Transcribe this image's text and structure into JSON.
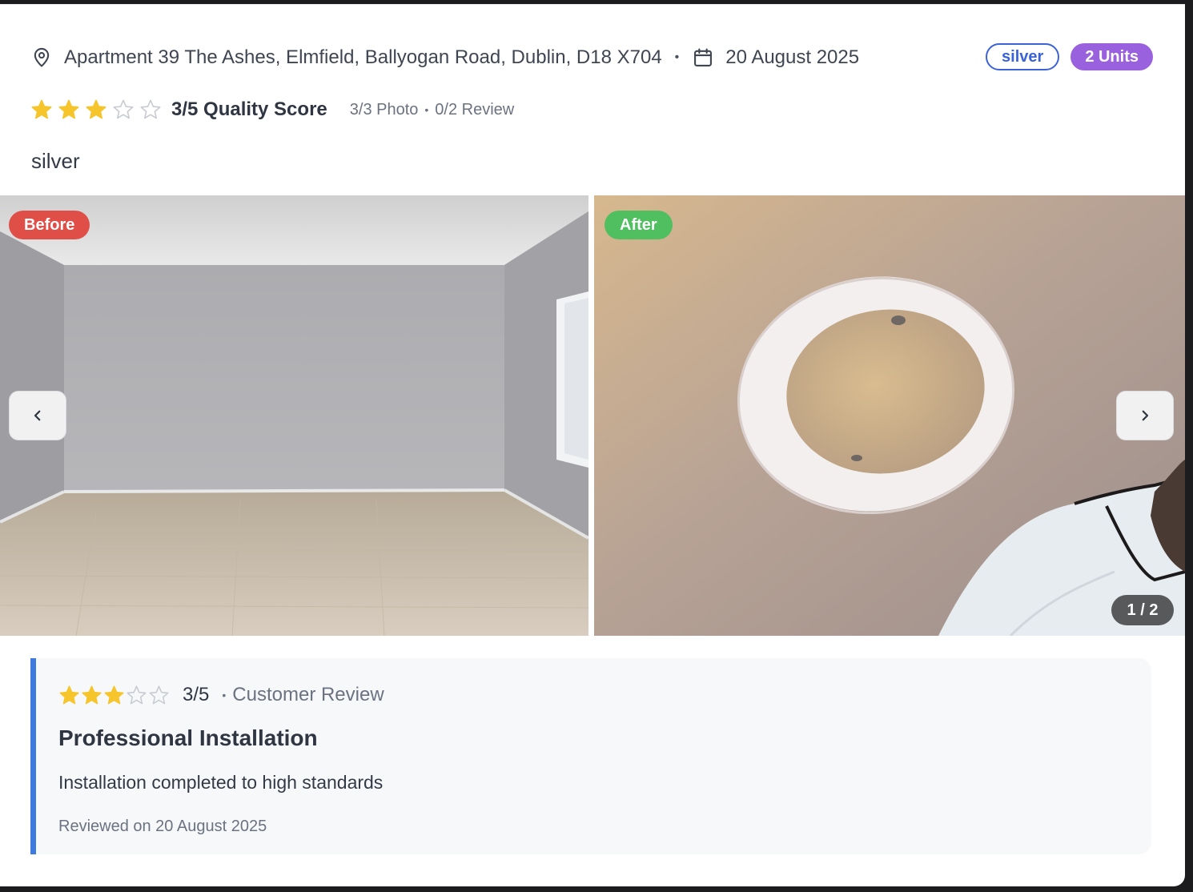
{
  "listing": {
    "address": "Apartment 39 The Ashes, Elmfield, Ballyogan Road, Dublin, D18 X704",
    "date": "20 August 2025",
    "tier_badge": "silver",
    "units_badge": "2 Units",
    "rating": 3,
    "rating_max": 5,
    "quality_score_text": "3/5 Quality Score",
    "photo_count": "3/3 Photo",
    "review_count": "0/2 Review",
    "tier_text": "silver"
  },
  "gallery": {
    "before_label": "Before",
    "after_label": "After",
    "counter": "1 / 2"
  },
  "review": {
    "rating": 3,
    "rating_max": 5,
    "score": "3/5",
    "type": "Customer Review",
    "title": "Professional Installation",
    "body": "Installation completed to high standards",
    "date_text": "Reviewed on 20 August 2025"
  },
  "colors": {
    "star_filled": "#f5c52b",
    "star_empty": "#c8cbd1",
    "badge_outline": "#3b63d8",
    "badge_solid": "#9a61de",
    "before": "#e04e48",
    "after": "#4fbf5f",
    "review_accent": "#3d7bdf"
  },
  "icons": [
    "location-pin-icon",
    "calendar-icon",
    "star-icon",
    "chevron-left-icon",
    "chevron-right-icon"
  ]
}
